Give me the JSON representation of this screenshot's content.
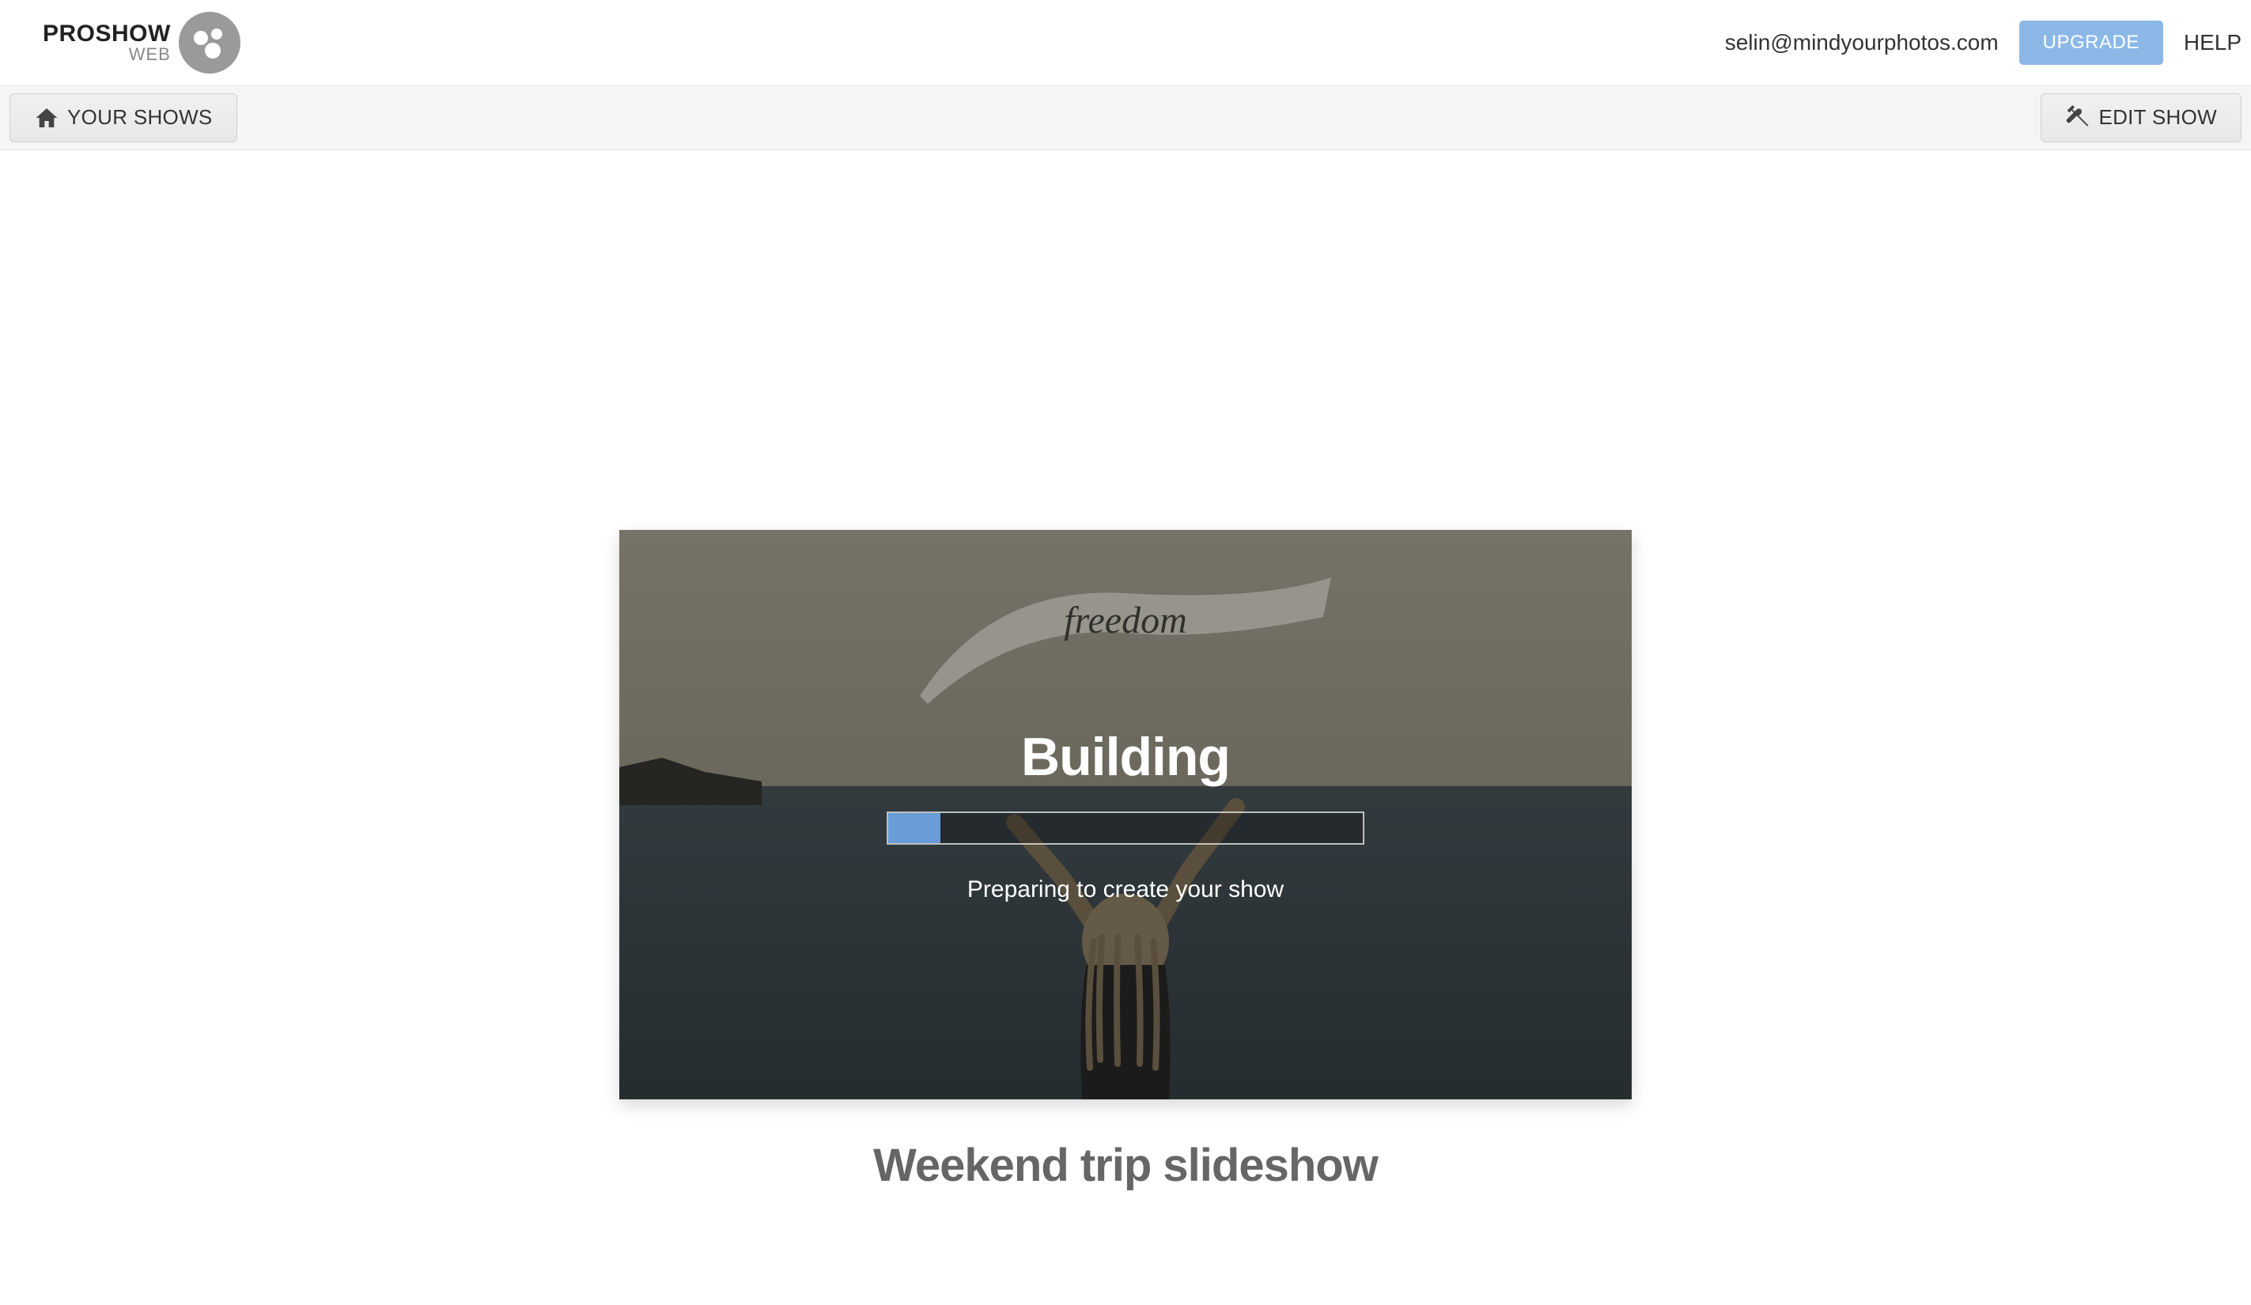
{
  "header": {
    "logo_main": "PROSHOW",
    "logo_sub": "WEB",
    "user_email": "selin@mindyourphotos.com",
    "upgrade_label": "UPGRADE",
    "help_label": "HELP"
  },
  "toolbar": {
    "your_shows_label": "YOUR SHOWS",
    "edit_show_label": "EDIT SHOW"
  },
  "preview": {
    "building_label": "Building",
    "progress_percent": 11,
    "status_message": "Preparing to create your show",
    "flag_text": "freedom"
  },
  "show": {
    "title": "Weekend trip slideshow"
  }
}
